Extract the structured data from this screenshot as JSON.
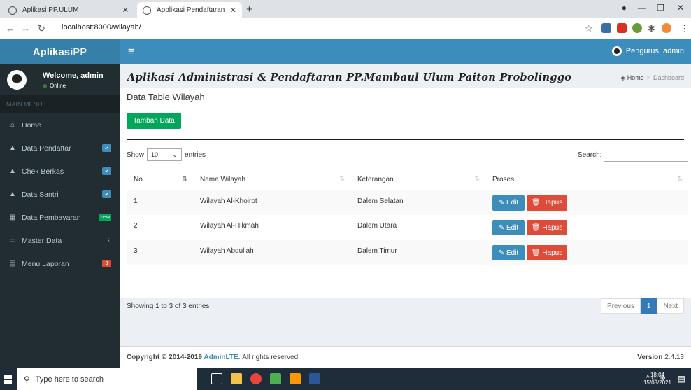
{
  "browser": {
    "tabs": [
      {
        "title": "Aplikasi PP.ULUM"
      },
      {
        "title": "Applikasi Pendaftaran"
      }
    ],
    "url_prefix": "ⓘ",
    "url": "localhost:8000/wilayah/"
  },
  "header": {
    "logo_bold": "Aplikasi",
    "logo_rest": "PP",
    "hamburger": "≡",
    "user": "Pengurus, admin"
  },
  "sidebar": {
    "welcome": "Welcome, admin",
    "status": "Online",
    "menu_header": "MAIN MENU",
    "items": [
      {
        "label": "Home",
        "icon": "home-icon",
        "glyph": "⌂"
      },
      {
        "label": "Data Pendaftar",
        "icon": "user-icon",
        "glyph": "▲",
        "badge": "✔",
        "badge_color": "blue"
      },
      {
        "label": "Chek Berkas",
        "icon": "user-icon",
        "glyph": "▲",
        "badge": "✔",
        "badge_color": "blue"
      },
      {
        "label": "Data Santri",
        "icon": "user-icon",
        "glyph": "▲",
        "badge": "✔",
        "badge_color": "blue"
      },
      {
        "label": "Data Pembayaran",
        "icon": "table-icon",
        "glyph": "▦",
        "badge": "new",
        "badge_color": "green"
      },
      {
        "label": "Master Data",
        "icon": "laptop-icon",
        "glyph": "▭",
        "caret": "‹"
      },
      {
        "label": "Menu Laporan",
        "icon": "calendar-icon",
        "glyph": "▤",
        "badge": "3",
        "badge_color": "red"
      }
    ]
  },
  "content": {
    "page_title": "Aplikasi Administrasi & Pendaftaran PP.Mambaul Ulum Paiton Probolinggo",
    "breadcrumb": {
      "home": "Home",
      "separator": ">",
      "current": "Dashboard"
    },
    "box_title": "Data Table Wilayah",
    "add_button": "Tambah Data",
    "length": {
      "show": "Show",
      "value": "10",
      "entries": "entries"
    },
    "search_label": "Search:",
    "columns": [
      "No",
      "Nama Wilayah",
      "Keterangan",
      "Proses"
    ],
    "rows": [
      {
        "no": "1",
        "nama": "Wilayah Al-Khoirot",
        "ket": "Dalem Selatan"
      },
      {
        "no": "2",
        "nama": "Wilayah Al-Hikmah",
        "ket": "Dalem Utara"
      },
      {
        "no": "3",
        "nama": "Wilayah Abdullah",
        "ket": "Dalem Timur"
      }
    ],
    "edit_label": "Edit",
    "delete_label": "Hapus",
    "info": "Showing 1 to 3 of 3 entries",
    "pagination": {
      "previous": "Previous",
      "page": "1",
      "next": "Next"
    }
  },
  "footer": {
    "copyright_prefix": "Copyright © 2014-2019",
    "brand": "AdminLTE.",
    "suffix": "All rights reserved.",
    "version_label": "Version",
    "version": "2.4.13"
  },
  "taskbar": {
    "search_placeholder": "Type here to search",
    "time": "18:04",
    "date": "15/08/2021"
  },
  "colors": {
    "header": "#3c8dbc",
    "logo": "#367fa9",
    "sidebar": "#222d32",
    "success": "#00a65a",
    "danger": "#dd4b39"
  }
}
